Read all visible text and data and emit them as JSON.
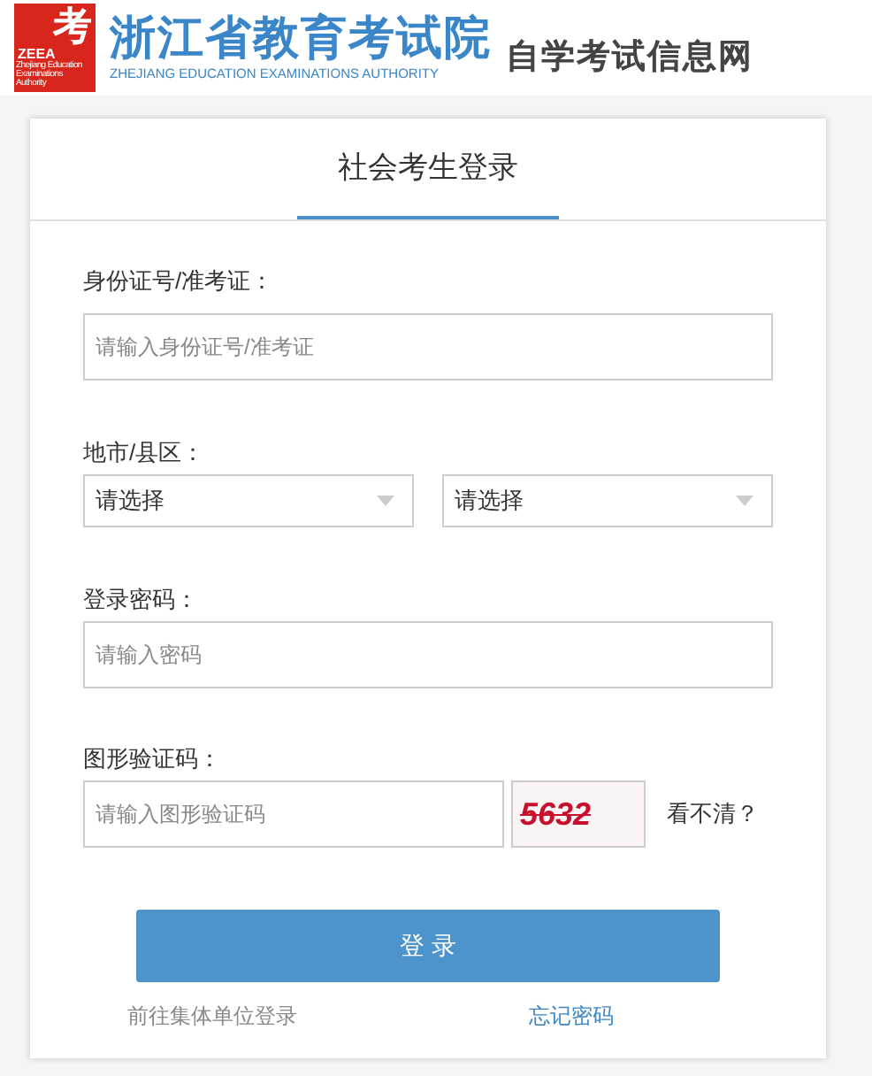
{
  "header": {
    "logo": {
      "glyph": "考",
      "acronym": "ZEEA",
      "caption": "Zhejiang Education Examinations Authority"
    },
    "title": "浙江省教育考试院",
    "subtitle": "ZHEJIANG EDUCATION EXAMINATIONS AUTHORITY",
    "site_name": "自学考试信息网"
  },
  "tabs": [
    {
      "label": "社会考生登录",
      "selected": true
    }
  ],
  "form": {
    "id_label": "身份证号/准考证：",
    "id_placeholder": "请输入身份证号/准考证",
    "region_label": "地市/县区：",
    "region_selects": [
      "请选择",
      "请选择"
    ],
    "password_label": "登录密码：",
    "password_placeholder": "请输入密码",
    "captcha_label": "图形验证码：",
    "captcha_placeholder": "请输入图形验证码",
    "captcha_code": "5632",
    "refresh_link": "看不清？",
    "submit": "登 录",
    "group_login_link": "前往集体单位登录",
    "forgot_link": "忘记密码"
  }
}
